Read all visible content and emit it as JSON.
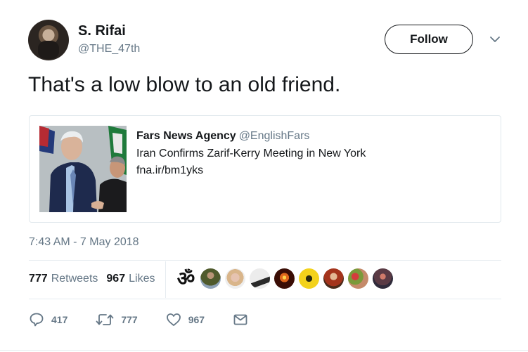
{
  "author": {
    "display_name": "S. Rifai",
    "handle": "@THE_47th",
    "avatar_icon": "profile-avatar"
  },
  "follow_label": "Follow",
  "tweet_text": "That's a low blow to an old friend.",
  "quoted": {
    "source_name": "Fars News Agency",
    "source_handle": "@EnglishFars",
    "title": "Iran Confirms Zarif-Kerry Meeting in New York",
    "link": "fna.ir/bm1yks"
  },
  "timestamp": "7:43 AM - 7 May 2018",
  "stats": {
    "retweets_count": "777",
    "retweets_label": "Retweets",
    "likes_count": "967",
    "likes_label": "Likes"
  },
  "likers": [
    "om-symbol",
    "soldier-avatar",
    "woman-avatar",
    "shoe-avatar",
    "candle-avatar",
    "gadsden-flag-avatar",
    "redhead-avatar",
    "flowers-avatar",
    "crowd-avatar"
  ],
  "actions": {
    "reply_count": "417",
    "retweet_count": "777",
    "like_count": "967"
  },
  "colors": {
    "text": "#14171a",
    "secondary": "#657786",
    "border": "#e1e8ed"
  }
}
